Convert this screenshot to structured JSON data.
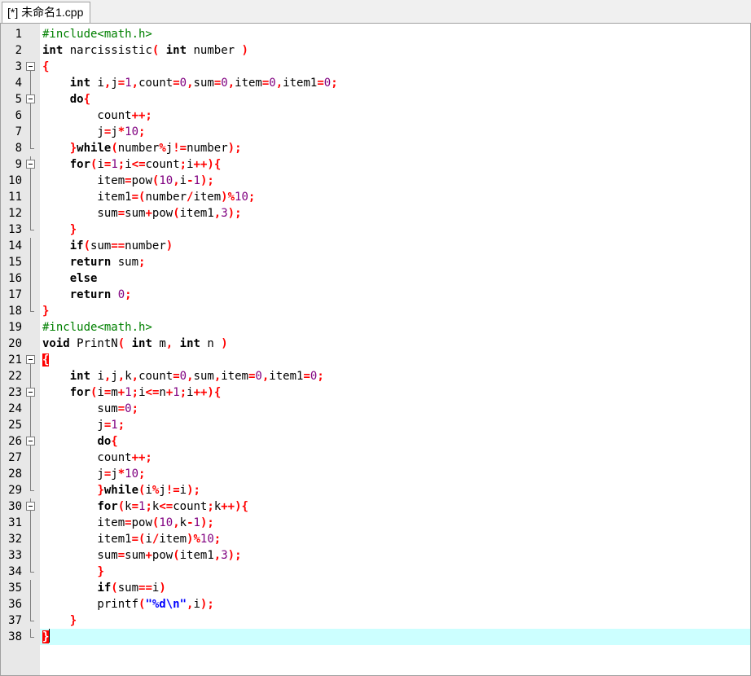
{
  "tab": {
    "title": "[*] 未命名1.cpp"
  },
  "colors": {
    "keyword": "#000000",
    "operator": "#ff0000",
    "number": "#800080",
    "preprocessor": "#008000",
    "string": "#0000ff",
    "current_line": "#ccffff",
    "gutter": "#e8e8e8"
  },
  "editor": {
    "current_line": 38,
    "lines": [
      {
        "n": "1",
        "fold": "none",
        "tokens": [
          [
            "#include<math.h>",
            "pp"
          ]
        ]
      },
      {
        "n": "2",
        "fold": "none",
        "tokens": [
          [
            "int",
            "kw"
          ],
          [
            " narcissistic",
            ""
          ],
          [
            "(",
            "op"
          ],
          [
            " ",
            ""
          ],
          [
            "int",
            "kw"
          ],
          [
            " number ",
            ""
          ],
          [
            ")",
            "op"
          ]
        ]
      },
      {
        "n": "3",
        "fold": "open",
        "tokens": [
          [
            "{",
            "op"
          ]
        ]
      },
      {
        "n": "4",
        "fold": "line",
        "tokens": [
          [
            "    ",
            ""
          ],
          [
            "int",
            "kw"
          ],
          [
            " i",
            ""
          ],
          [
            ",",
            "op"
          ],
          [
            "j",
            ""
          ],
          [
            "=",
            "op"
          ],
          [
            "1",
            "num"
          ],
          [
            ",",
            "op"
          ],
          [
            "count",
            ""
          ],
          [
            "=",
            "op"
          ],
          [
            "0",
            "num"
          ],
          [
            ",",
            "op"
          ],
          [
            "sum",
            ""
          ],
          [
            "=",
            "op"
          ],
          [
            "0",
            "num"
          ],
          [
            ",",
            "op"
          ],
          [
            "item",
            ""
          ],
          [
            "=",
            "op"
          ],
          [
            "0",
            "num"
          ],
          [
            ",",
            "op"
          ],
          [
            "item1",
            ""
          ],
          [
            "=",
            "op"
          ],
          [
            "0",
            "num"
          ],
          [
            ";",
            "op"
          ]
        ]
      },
      {
        "n": "5",
        "fold": "open-inner",
        "tokens": [
          [
            "    ",
            ""
          ],
          [
            "do",
            "kw"
          ],
          [
            "{",
            "op"
          ]
        ]
      },
      {
        "n": "6",
        "fold": "line",
        "tokens": [
          [
            "        count",
            ""
          ],
          [
            "++;",
            "op"
          ]
        ]
      },
      {
        "n": "7",
        "fold": "line",
        "tokens": [
          [
            "        j",
            ""
          ],
          [
            "=",
            "op"
          ],
          [
            "j",
            ""
          ],
          [
            "*",
            "op"
          ],
          [
            "10",
            "num"
          ],
          [
            ";",
            "op"
          ]
        ]
      },
      {
        "n": "8",
        "fold": "end",
        "tokens": [
          [
            "    ",
            ""
          ],
          [
            "}",
            "op"
          ],
          [
            "while",
            "kw"
          ],
          [
            "(",
            "op"
          ],
          [
            "number",
            ""
          ],
          [
            "%",
            "op"
          ],
          [
            "j",
            ""
          ],
          [
            "!=",
            "op"
          ],
          [
            "number",
            ""
          ],
          [
            ");",
            "op"
          ]
        ]
      },
      {
        "n": "9",
        "fold": "open-inner",
        "tokens": [
          [
            "    ",
            ""
          ],
          [
            "for",
            "kw"
          ],
          [
            "(",
            "op"
          ],
          [
            "i",
            ""
          ],
          [
            "=",
            "op"
          ],
          [
            "1",
            "num"
          ],
          [
            ";",
            "op"
          ],
          [
            "i",
            ""
          ],
          [
            "<=",
            "op"
          ],
          [
            "count",
            ""
          ],
          [
            ";",
            "op"
          ],
          [
            "i",
            ""
          ],
          [
            "++){",
            "op"
          ]
        ]
      },
      {
        "n": "10",
        "fold": "line",
        "tokens": [
          [
            "        item",
            ""
          ],
          [
            "=",
            "op"
          ],
          [
            "pow",
            ""
          ],
          [
            "(",
            "op"
          ],
          [
            "10",
            "num"
          ],
          [
            ",",
            "op"
          ],
          [
            "i",
            ""
          ],
          [
            "-",
            "op"
          ],
          [
            "1",
            "num"
          ],
          [
            ");",
            "op"
          ]
        ]
      },
      {
        "n": "11",
        "fold": "line",
        "tokens": [
          [
            "        item1",
            ""
          ],
          [
            "=(",
            "op"
          ],
          [
            "number",
            ""
          ],
          [
            "/",
            "op"
          ],
          [
            "item",
            ""
          ],
          [
            ")%",
            "op"
          ],
          [
            "10",
            "num"
          ],
          [
            ";",
            "op"
          ]
        ]
      },
      {
        "n": "12",
        "fold": "line",
        "tokens": [
          [
            "        sum",
            ""
          ],
          [
            "=",
            "op"
          ],
          [
            "sum",
            ""
          ],
          [
            "+",
            "op"
          ],
          [
            "pow",
            ""
          ],
          [
            "(",
            "op"
          ],
          [
            "item1",
            ""
          ],
          [
            ",",
            "op"
          ],
          [
            "3",
            "num"
          ],
          [
            ");",
            "op"
          ]
        ]
      },
      {
        "n": "13",
        "fold": "end",
        "tokens": [
          [
            "    ",
            ""
          ],
          [
            "}",
            "op"
          ]
        ]
      },
      {
        "n": "14",
        "fold": "line",
        "tokens": [
          [
            "    ",
            ""
          ],
          [
            "if",
            "kw"
          ],
          [
            "(",
            "op"
          ],
          [
            "sum",
            ""
          ],
          [
            "==",
            "op"
          ],
          [
            "number",
            ""
          ],
          [
            ")",
            "op"
          ]
        ]
      },
      {
        "n": "15",
        "fold": "line",
        "tokens": [
          [
            "    ",
            ""
          ],
          [
            "return",
            "kw"
          ],
          [
            " sum",
            ""
          ],
          [
            ";",
            "op"
          ]
        ]
      },
      {
        "n": "16",
        "fold": "line",
        "tokens": [
          [
            "    ",
            ""
          ],
          [
            "else",
            "kw"
          ]
        ]
      },
      {
        "n": "17",
        "fold": "line",
        "tokens": [
          [
            "    ",
            ""
          ],
          [
            "return",
            "kw"
          ],
          [
            " ",
            ""
          ],
          [
            "0",
            "num"
          ],
          [
            ";",
            "op"
          ]
        ]
      },
      {
        "n": "18",
        "fold": "end",
        "tokens": [
          [
            "}",
            "op"
          ]
        ]
      },
      {
        "n": "19",
        "fold": "none",
        "tokens": [
          [
            "#include<math.h>",
            "pp"
          ]
        ]
      },
      {
        "n": "20",
        "fold": "none",
        "tokens": [
          [
            "void",
            "kw"
          ],
          [
            " PrintN",
            ""
          ],
          [
            "(",
            "op"
          ],
          [
            " ",
            ""
          ],
          [
            "int",
            "kw"
          ],
          [
            " m",
            ""
          ],
          [
            ",",
            "op"
          ],
          [
            " ",
            ""
          ],
          [
            "int",
            "kw"
          ],
          [
            " n ",
            ""
          ],
          [
            ")",
            "op"
          ]
        ]
      },
      {
        "n": "21",
        "fold": "open",
        "tokens": [
          [
            "{",
            "bm"
          ]
        ]
      },
      {
        "n": "22",
        "fold": "line",
        "tokens": [
          [
            "    ",
            ""
          ],
          [
            "int",
            "kw"
          ],
          [
            " i",
            ""
          ],
          [
            ",",
            "op"
          ],
          [
            "j",
            ""
          ],
          [
            ",",
            "op"
          ],
          [
            "k",
            ""
          ],
          [
            ",",
            "op"
          ],
          [
            "count",
            ""
          ],
          [
            "=",
            "op"
          ],
          [
            "0",
            "num"
          ],
          [
            ",",
            "op"
          ],
          [
            "sum",
            ""
          ],
          [
            ",",
            "op"
          ],
          [
            "item",
            ""
          ],
          [
            "=",
            "op"
          ],
          [
            "0",
            "num"
          ],
          [
            ",",
            "op"
          ],
          [
            "item1",
            ""
          ],
          [
            "=",
            "op"
          ],
          [
            "0",
            "num"
          ],
          [
            ";",
            "op"
          ]
        ]
      },
      {
        "n": "23",
        "fold": "open-inner",
        "tokens": [
          [
            "    ",
            ""
          ],
          [
            "for",
            "kw"
          ],
          [
            "(",
            "op"
          ],
          [
            "i",
            ""
          ],
          [
            "=",
            "op"
          ],
          [
            "m",
            ""
          ],
          [
            "+",
            "op"
          ],
          [
            "1",
            "num"
          ],
          [
            ";",
            "op"
          ],
          [
            "i",
            ""
          ],
          [
            "<=",
            "op"
          ],
          [
            "n",
            ""
          ],
          [
            "+",
            "op"
          ],
          [
            "1",
            "num"
          ],
          [
            ";",
            "op"
          ],
          [
            "i",
            ""
          ],
          [
            "++){",
            "op"
          ]
        ]
      },
      {
        "n": "24",
        "fold": "line",
        "tokens": [
          [
            "        sum",
            ""
          ],
          [
            "=",
            "op"
          ],
          [
            "0",
            "num"
          ],
          [
            ";",
            "op"
          ]
        ]
      },
      {
        "n": "25",
        "fold": "line",
        "tokens": [
          [
            "        j",
            ""
          ],
          [
            "=",
            "op"
          ],
          [
            "1",
            "num"
          ],
          [
            ";",
            "op"
          ]
        ]
      },
      {
        "n": "26",
        "fold": "open-inner",
        "tokens": [
          [
            "        ",
            ""
          ],
          [
            "do",
            "kw"
          ],
          [
            "{",
            "op"
          ]
        ]
      },
      {
        "n": "27",
        "fold": "line",
        "tokens": [
          [
            "        count",
            ""
          ],
          [
            "++;",
            "op"
          ]
        ]
      },
      {
        "n": "28",
        "fold": "line",
        "tokens": [
          [
            "        j",
            ""
          ],
          [
            "=",
            "op"
          ],
          [
            "j",
            ""
          ],
          [
            "*",
            "op"
          ],
          [
            "10",
            "num"
          ],
          [
            ";",
            "op"
          ]
        ]
      },
      {
        "n": "29",
        "fold": "end",
        "tokens": [
          [
            "        ",
            ""
          ],
          [
            "}",
            "op"
          ],
          [
            "while",
            "kw"
          ],
          [
            "(",
            "op"
          ],
          [
            "i",
            ""
          ],
          [
            "%",
            "op"
          ],
          [
            "j",
            ""
          ],
          [
            "!=",
            "op"
          ],
          [
            "i",
            ""
          ],
          [
            ");",
            "op"
          ]
        ]
      },
      {
        "n": "30",
        "fold": "open-inner",
        "tokens": [
          [
            "        ",
            ""
          ],
          [
            "for",
            "kw"
          ],
          [
            "(",
            "op"
          ],
          [
            "k",
            ""
          ],
          [
            "=",
            "op"
          ],
          [
            "1",
            "num"
          ],
          [
            ";",
            "op"
          ],
          [
            "k",
            ""
          ],
          [
            "<=",
            "op"
          ],
          [
            "count",
            ""
          ],
          [
            ";",
            "op"
          ],
          [
            "k",
            ""
          ],
          [
            "++){",
            "op"
          ]
        ]
      },
      {
        "n": "31",
        "fold": "line",
        "tokens": [
          [
            "        item",
            ""
          ],
          [
            "=",
            "op"
          ],
          [
            "pow",
            ""
          ],
          [
            "(",
            "op"
          ],
          [
            "10",
            "num"
          ],
          [
            ",",
            "op"
          ],
          [
            "k",
            ""
          ],
          [
            "-",
            "op"
          ],
          [
            "1",
            "num"
          ],
          [
            ");",
            "op"
          ]
        ]
      },
      {
        "n": "32",
        "fold": "line",
        "tokens": [
          [
            "        item1",
            ""
          ],
          [
            "=(",
            "op"
          ],
          [
            "i",
            ""
          ],
          [
            "/",
            "op"
          ],
          [
            "item",
            ""
          ],
          [
            ")%",
            "op"
          ],
          [
            "10",
            "num"
          ],
          [
            ";",
            "op"
          ]
        ]
      },
      {
        "n": "33",
        "fold": "line",
        "tokens": [
          [
            "        sum",
            ""
          ],
          [
            "=",
            "op"
          ],
          [
            "sum",
            ""
          ],
          [
            "+",
            "op"
          ],
          [
            "pow",
            ""
          ],
          [
            "(",
            "op"
          ],
          [
            "item1",
            ""
          ],
          [
            ",",
            "op"
          ],
          [
            "3",
            "num"
          ],
          [
            ");",
            "op"
          ]
        ]
      },
      {
        "n": "34",
        "fold": "end",
        "tokens": [
          [
            "        ",
            ""
          ],
          [
            "}",
            "op"
          ]
        ]
      },
      {
        "n": "35",
        "fold": "line",
        "tokens": [
          [
            "        ",
            ""
          ],
          [
            "if",
            "kw"
          ],
          [
            "(",
            "op"
          ],
          [
            "sum",
            ""
          ],
          [
            "==",
            "op"
          ],
          [
            "i",
            ""
          ],
          [
            ")",
            "op"
          ]
        ]
      },
      {
        "n": "36",
        "fold": "line",
        "tokens": [
          [
            "        printf",
            ""
          ],
          [
            "(",
            "op"
          ],
          [
            "\"%d\\n\"",
            "str"
          ],
          [
            ",",
            "op"
          ],
          [
            "i",
            ""
          ],
          [
            ");",
            "op"
          ]
        ]
      },
      {
        "n": "37",
        "fold": "end",
        "tokens": [
          [
            "    ",
            ""
          ],
          [
            "}",
            "op"
          ]
        ]
      },
      {
        "n": "38",
        "fold": "end",
        "tokens": [
          [
            "}",
            "bm"
          ]
        ]
      }
    ]
  }
}
